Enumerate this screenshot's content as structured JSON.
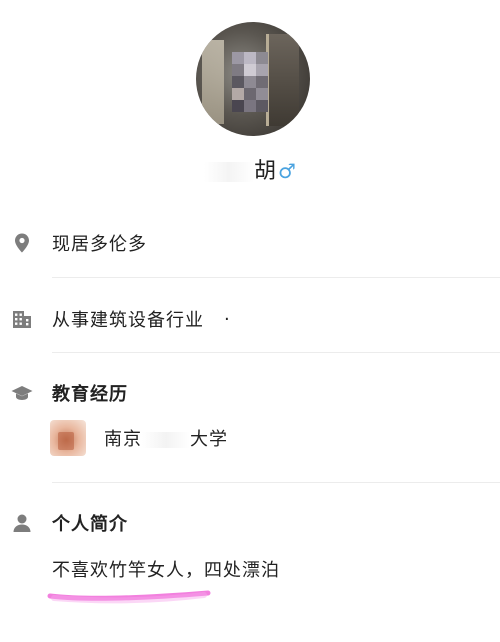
{
  "profile": {
    "name": "胡",
    "gender_icon": "male-symbol-icon",
    "gender_symbol": "♂",
    "accent_colors": {
      "male_icon": "#4aa3e0",
      "highlight": "#f06ad8"
    }
  },
  "info": {
    "location": {
      "icon": "location-pin-icon",
      "text": "现居多伦多"
    },
    "occupation": {
      "icon": "building-icon",
      "text": "从事建筑设备行业",
      "trailing_mark": "·"
    },
    "education": {
      "icon": "graduation-cap-icon",
      "title": "教育经历",
      "school_prefix": "南京",
      "school_suffix": "大学"
    },
    "bio": {
      "icon": "person-icon",
      "title": "个人简介",
      "text": "不喜欢竹竿女人，四处漂泊"
    }
  }
}
